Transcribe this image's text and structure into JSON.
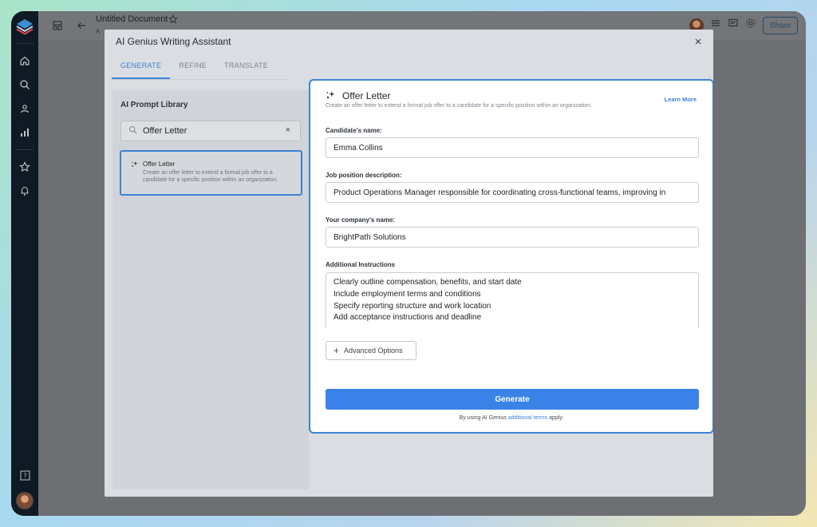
{
  "app": {
    "doc_title": "Untitled Document",
    "doc_sub": "A",
    "share_label": "Share"
  },
  "modal": {
    "title": "AI Genius Writing Assistant",
    "close": "×",
    "tabs": [
      {
        "label": "GENERATE",
        "active": true
      },
      {
        "label": "REFINE",
        "active": false
      },
      {
        "label": "TRANSLATE",
        "active": false
      }
    ]
  },
  "library": {
    "title": "AI Prompt Library",
    "search_value": "Offer Letter",
    "clear": "×",
    "item": {
      "title": "Offer Letter",
      "description": "Create an offer letter to extend a formal job offer to a candidate for a specific position within an organization."
    }
  },
  "form": {
    "title": "Offer Letter",
    "description": "Create an offer letter to extend a formal job offer to a candidate for a specific position within an organization.",
    "learn_more": "Learn More",
    "candidate_label": "Candidate's name:",
    "candidate_value": "Emma Collins",
    "job_label": "Job position description:",
    "job_value": "Product Operations Manager responsible for coordinating cross-functional teams, improving in",
    "company_label": "Your company's name:",
    "company_value": "BrightPath Solutions",
    "instructions_label": "Additional Instructions",
    "instructions_lines": [
      "Clearly outline compensation, benefits, and start date",
      "Include employment terms and conditions",
      "Specify reporting structure and work location",
      "Add acceptance instructions and deadline"
    ],
    "advanced_label": "Advanced Options",
    "generate_label": "Generate",
    "terms_prefix": "By using AI Genius",
    "terms_link": "additional terms",
    "terms_suffix": "apply."
  },
  "colors": {
    "accent": "#3b82d6",
    "nav_bg": "#0f1a24"
  }
}
